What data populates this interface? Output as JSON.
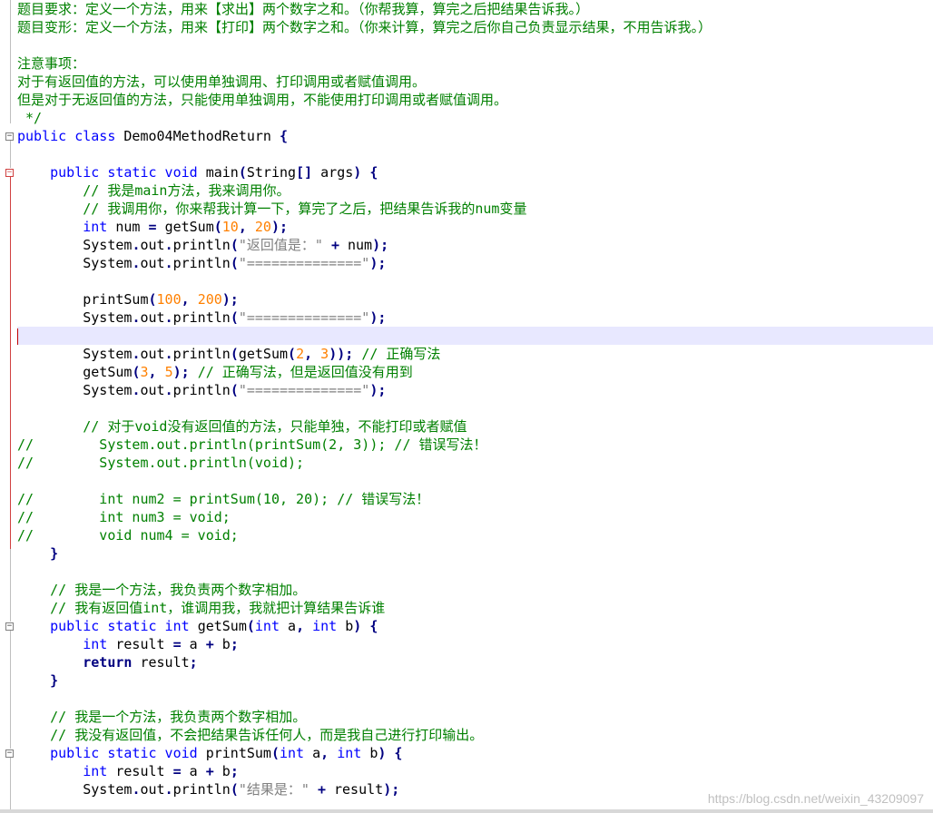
{
  "editor": {
    "lines": [
      [
        [
          "cm",
          "题目要求：定义一个方法，用来【求出】两个数字之和。（你帮我算，算完之后把结果告诉我。）"
        ]
      ],
      [
        [
          "cm",
          "题目变形：定义一个方法，用来【打印】两个数字之和。（你来计算，算完之后你自己负责显示结果，不用告诉我。）"
        ]
      ],
      [],
      [
        [
          "cm",
          "注意事项："
        ]
      ],
      [
        [
          "cm",
          "对于有返回值的方法，可以使用单独调用、打印调用或者赋值调用。"
        ]
      ],
      [
        [
          "cm",
          "但是对于无返回值的方法，只能使用单独调用，不能使用打印调用或者赋值调用。"
        ]
      ],
      [
        [
          "cm",
          " */"
        ]
      ],
      [
        [
          "kw",
          "public class "
        ],
        [
          "plain",
          "Demo04MethodReturn "
        ],
        [
          "op",
          "{"
        ]
      ],
      [],
      [
        [
          "plain",
          "    "
        ],
        [
          "kw",
          "public static void "
        ],
        [
          "plain",
          "main"
        ],
        [
          "op",
          "("
        ],
        [
          "plain",
          "String"
        ],
        [
          "op",
          "[] "
        ],
        [
          "plain",
          "args"
        ],
        [
          "op",
          ") {"
        ]
      ],
      [
        [
          "plain",
          "        "
        ],
        [
          "cm",
          "// 我是main方法，我来调用你。"
        ]
      ],
      [
        [
          "plain",
          "        "
        ],
        [
          "cm",
          "// 我调用你，你来帮我计算一下，算完了之后，把结果告诉我的num变量"
        ]
      ],
      [
        [
          "plain",
          "        "
        ],
        [
          "kw",
          "int "
        ],
        [
          "plain",
          "num "
        ],
        [
          "op",
          "= "
        ],
        [
          "plain",
          "getSum"
        ],
        [
          "op",
          "("
        ],
        [
          "num",
          "10"
        ],
        [
          "op",
          ", "
        ],
        [
          "num",
          "20"
        ],
        [
          "op",
          ");"
        ]
      ],
      [
        [
          "plain",
          "        System"
        ],
        [
          "op",
          "."
        ],
        [
          "plain",
          "out"
        ],
        [
          "op",
          "."
        ],
        [
          "plain",
          "println"
        ],
        [
          "op",
          "("
        ],
        [
          "str",
          "\"返回值是：\" "
        ],
        [
          "op",
          "+ "
        ],
        [
          "plain",
          "num"
        ],
        [
          "op",
          ");"
        ]
      ],
      [
        [
          "plain",
          "        System"
        ],
        [
          "op",
          "."
        ],
        [
          "plain",
          "out"
        ],
        [
          "op",
          "."
        ],
        [
          "plain",
          "println"
        ],
        [
          "op",
          "("
        ],
        [
          "str",
          "\"==============\""
        ],
        [
          "op",
          ");"
        ]
      ],
      [],
      [
        [
          "plain",
          "        printSum"
        ],
        [
          "op",
          "("
        ],
        [
          "num",
          "100"
        ],
        [
          "op",
          ", "
        ],
        [
          "num",
          "200"
        ],
        [
          "op",
          ");"
        ]
      ],
      [
        [
          "plain",
          "        System"
        ],
        [
          "op",
          "."
        ],
        [
          "plain",
          "out"
        ],
        [
          "op",
          "."
        ],
        [
          "plain",
          "println"
        ],
        [
          "op",
          "("
        ],
        [
          "str",
          "\"==============\""
        ],
        [
          "op",
          ");"
        ]
      ],
      [],
      [
        [
          "plain",
          "        System"
        ],
        [
          "op",
          "."
        ],
        [
          "plain",
          "out"
        ],
        [
          "op",
          "."
        ],
        [
          "plain",
          "println"
        ],
        [
          "op",
          "("
        ],
        [
          "plain",
          "getSum"
        ],
        [
          "op",
          "("
        ],
        [
          "num",
          "2"
        ],
        [
          "op",
          ", "
        ],
        [
          "num",
          "3"
        ],
        [
          "op",
          ")); "
        ],
        [
          "cm",
          "// 正确写法"
        ]
      ],
      [
        [
          "plain",
          "        getSum"
        ],
        [
          "op",
          "("
        ],
        [
          "num",
          "3"
        ],
        [
          "op",
          ", "
        ],
        [
          "num",
          "5"
        ],
        [
          "op",
          "); "
        ],
        [
          "cm",
          "// 正确写法，但是返回值没有用到"
        ]
      ],
      [
        [
          "plain",
          "        System"
        ],
        [
          "op",
          "."
        ],
        [
          "plain",
          "out"
        ],
        [
          "op",
          "."
        ],
        [
          "plain",
          "println"
        ],
        [
          "op",
          "("
        ],
        [
          "str",
          "\"==============\""
        ],
        [
          "op",
          ");"
        ]
      ],
      [],
      [
        [
          "plain",
          "        "
        ],
        [
          "cm",
          "// 对于void没有返回值的方法，只能单独，不能打印或者赋值"
        ]
      ],
      [
        [
          "cm",
          "//        System.out.println(printSum(2, 3)); // 错误写法！"
        ]
      ],
      [
        [
          "cm",
          "//        System.out.println(void);"
        ]
      ],
      [],
      [
        [
          "cm",
          "//        int num2 = printSum(10, 20); // 错误写法！"
        ]
      ],
      [
        [
          "cm",
          "//        int num3 = void;"
        ]
      ],
      [
        [
          "cm",
          "//        void num4 = void;"
        ]
      ],
      [
        [
          "plain",
          "    "
        ],
        [
          "op",
          "}"
        ]
      ],
      [],
      [
        [
          "plain",
          "    "
        ],
        [
          "cm",
          "// 我是一个方法，我负责两个数字相加。"
        ]
      ],
      [
        [
          "plain",
          "    "
        ],
        [
          "cm",
          "// 我有返回值int，谁调用我，我就把计算结果告诉谁"
        ]
      ],
      [
        [
          "plain",
          "    "
        ],
        [
          "kw",
          "public static int "
        ],
        [
          "plain",
          "getSum"
        ],
        [
          "op",
          "("
        ],
        [
          "kw",
          "int "
        ],
        [
          "plain",
          "a"
        ],
        [
          "op",
          ", "
        ],
        [
          "kw",
          "int "
        ],
        [
          "plain",
          "b"
        ],
        [
          "op",
          ") {"
        ]
      ],
      [
        [
          "plain",
          "        "
        ],
        [
          "kw",
          "int "
        ],
        [
          "plain",
          "result "
        ],
        [
          "op",
          "= "
        ],
        [
          "plain",
          "a "
        ],
        [
          "op",
          "+ "
        ],
        [
          "plain",
          "b"
        ],
        [
          "op",
          ";"
        ]
      ],
      [
        [
          "plain",
          "        "
        ],
        [
          "kwb",
          "return "
        ],
        [
          "plain",
          "result"
        ],
        [
          "op",
          ";"
        ]
      ],
      [
        [
          "plain",
          "    "
        ],
        [
          "op",
          "}"
        ]
      ],
      [],
      [
        [
          "plain",
          "    "
        ],
        [
          "cm",
          "// 我是一个方法，我负责两个数字相加。"
        ]
      ],
      [
        [
          "plain",
          "    "
        ],
        [
          "cm",
          "// 我没有返回值，不会把结果告诉任何人，而是我自己进行打印输出。"
        ]
      ],
      [
        [
          "plain",
          "    "
        ],
        [
          "kw",
          "public static void "
        ],
        [
          "plain",
          "printSum"
        ],
        [
          "op",
          "("
        ],
        [
          "kw",
          "int "
        ],
        [
          "plain",
          "a"
        ],
        [
          "op",
          ", "
        ],
        [
          "kw",
          "int "
        ],
        [
          "plain",
          "b"
        ],
        [
          "op",
          ") {"
        ]
      ],
      [
        [
          "plain",
          "        "
        ],
        [
          "kw",
          "int "
        ],
        [
          "plain",
          "result "
        ],
        [
          "op",
          "= "
        ],
        [
          "plain",
          "a "
        ],
        [
          "op",
          "+ "
        ],
        [
          "plain",
          "b"
        ],
        [
          "op",
          ";"
        ]
      ],
      [
        [
          "plain",
          "        System"
        ],
        [
          "op",
          "."
        ],
        [
          "plain",
          "out"
        ],
        [
          "op",
          "."
        ],
        [
          "plain",
          "println"
        ],
        [
          "op",
          "("
        ],
        [
          "str",
          "\"结果是：\" "
        ],
        [
          "op",
          "+ "
        ],
        [
          "plain",
          "result"
        ],
        [
          "op",
          ");"
        ]
      ]
    ]
  },
  "watermark": "https://blog.csdn.net/weixin_43209097"
}
